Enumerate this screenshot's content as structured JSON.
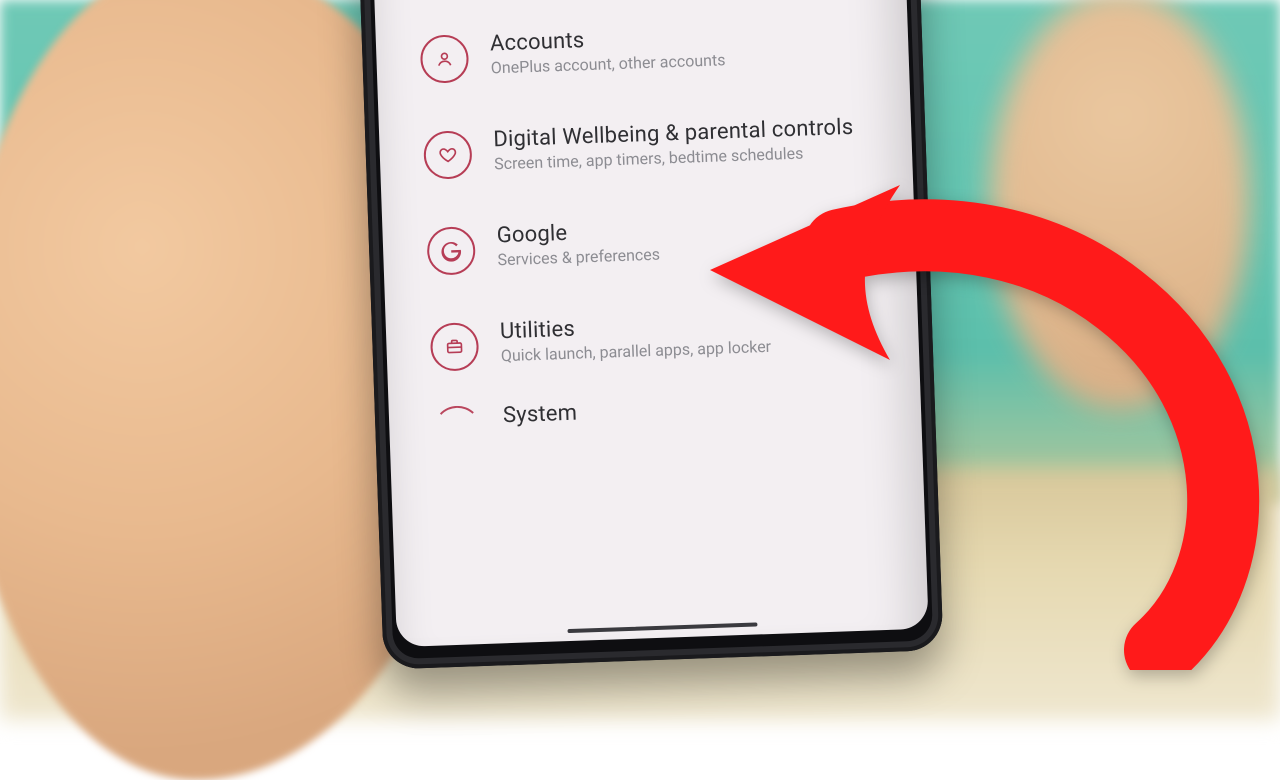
{
  "accent": "#b02a45",
  "arrow_color": "#ff1a1a",
  "settings": {
    "items": [
      {
        "icon": "user-icon",
        "title": "Accounts",
        "sub": "OnePlus account, other accounts"
      },
      {
        "icon": "heart-icon",
        "title": "Digital Wellbeing & parental controls",
        "sub": "Screen time, app timers, bedtime schedules"
      },
      {
        "icon": "google-icon",
        "title": "Google",
        "sub": "Services & preferences"
      },
      {
        "icon": "briefcase-icon",
        "title": "Utilities",
        "sub": "Quick launch, parallel apps, app locker"
      }
    ],
    "partial_item_title": "System"
  }
}
